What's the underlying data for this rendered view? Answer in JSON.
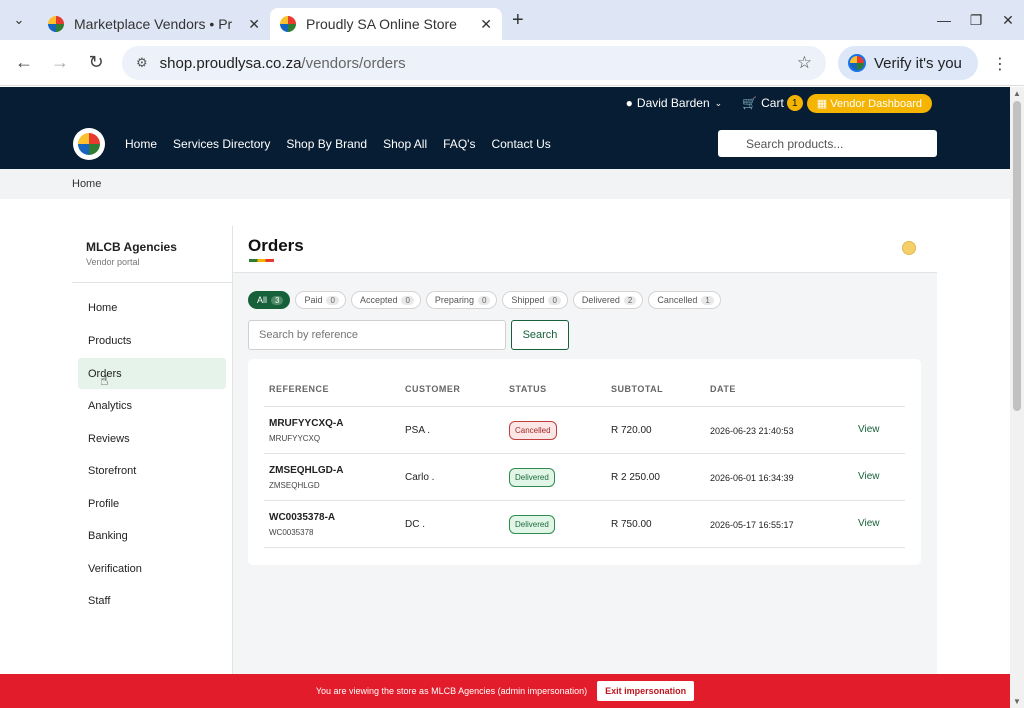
{
  "browser": {
    "tabs": [
      {
        "title": "Marketplace Vendors • Pr",
        "active": false
      },
      {
        "title": "Proudly SA Online Store",
        "active": true
      }
    ],
    "url_host": "shop.proudlysa.co.za",
    "url_path": "/vendors/orders",
    "verify_label": "Verify it's you"
  },
  "topbar": {
    "user_name": "David Barden",
    "cart_label": "Cart",
    "cart_count": "1",
    "vendor_dashboard": "Vendor Dashboard"
  },
  "nav": {
    "items": [
      "Home",
      "Services Directory",
      "Shop By Brand",
      "Shop All",
      "FAQ's",
      "Contact Us"
    ],
    "search_placeholder": "Search products..."
  },
  "breadcrumb": "Home",
  "sidebar": {
    "vendor_name": "MLCB Agencies",
    "vendor_sub": "Vendor portal",
    "items": [
      "Home",
      "Products",
      "Orders",
      "Analytics",
      "Reviews",
      "Storefront",
      "Profile",
      "Banking",
      "Verification",
      "Staff"
    ],
    "active": "Orders"
  },
  "orders": {
    "title": "Orders",
    "filters": [
      {
        "label": "All",
        "count": "3",
        "active": true
      },
      {
        "label": "Paid",
        "count": "0"
      },
      {
        "label": "Accepted",
        "count": "0"
      },
      {
        "label": "Preparing",
        "count": "0"
      },
      {
        "label": "Shipped",
        "count": "0"
      },
      {
        "label": "Delivered",
        "count": "2"
      },
      {
        "label": "Cancelled",
        "count": "1"
      }
    ],
    "search_placeholder": "Search by reference",
    "search_button": "Search",
    "columns": [
      "REFERENCE",
      "CUSTOMER",
      "STATUS",
      "SUBTOTAL",
      "DATE"
    ],
    "rows": [
      {
        "ref": "MRUFYYCXQ-A",
        "ref_sub": "MRUFYYCXQ",
        "customer": "PSA .",
        "status": "Cancelled",
        "subtotal": "R 720.00",
        "date": "2026-06-23 21:40:53",
        "action": "View"
      },
      {
        "ref": "ZMSEQHLGD-A",
        "ref_sub": "ZMSEQHLGD",
        "customer": "Carlo .",
        "status": "Delivered",
        "subtotal": "R 2 250.00",
        "date": "2026-06-01 16:34:39",
        "action": "View"
      },
      {
        "ref": "WC0035378-A",
        "ref_sub": "WC0035378",
        "customer": "DC .",
        "status": "Delivered",
        "subtotal": "R 750.00",
        "date": "2026-05-17 16:55:17",
        "action": "View"
      }
    ]
  },
  "banner": {
    "message": "You are viewing the store as MLCB Agencies (admin impersonation)",
    "exit_label": "Exit impersonation"
  },
  "colors": {
    "navy": "#071d33",
    "accent_green": "#17613a",
    "gold": "#f5b400",
    "banner_red": "#e21c2a"
  }
}
